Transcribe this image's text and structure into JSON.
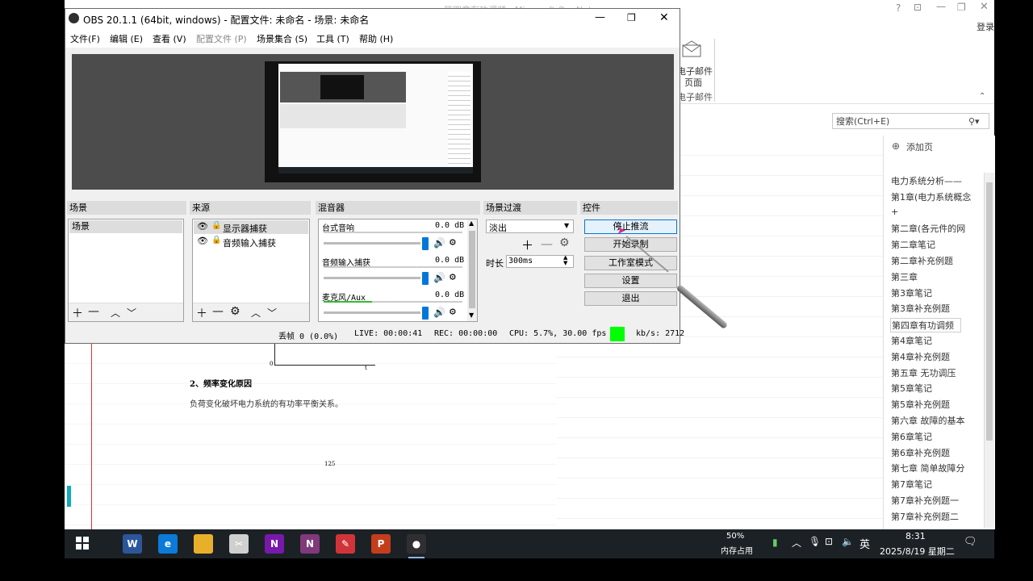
{
  "onenote": {
    "title_blurred": "第四章有功调频 - Microsoft OneNote",
    "signin": "登录",
    "ribbon": {
      "email_page_line1": "电子邮件",
      "email_page_line2": "页面",
      "group_label": "电子邮件"
    },
    "search_placeholder": "搜索(Ctrl+E)",
    "add_page": "添加页",
    "pages": [
      "电力系统分析——",
      "第1章(电力系统概念",
      "+",
      "第二章(各元件的网",
      "第二章笔记",
      "第二章补充例题",
      "第三章",
      "第3章笔记",
      "第3章补充例题",
      "第四章有功调频",
      "第4章笔记",
      "第4章补充例题",
      "第五章  无功调压",
      "第5章笔记",
      "第5章补充例题",
      "第六章 故障的基本",
      "第6章笔记",
      "第6章补充例题",
      "第七章 简单故障分",
      "第7章笔记",
      "第7章补充例题一",
      "第7章补充例题二"
    ],
    "selected_page_index": 9,
    "doc": {
      "axis_origin": "0",
      "axis_t": "t",
      "heading": "2、频率变化原因",
      "body": "负荷变化破坏电力系统的有功率平衡关系。",
      "page_number": "125"
    }
  },
  "obs": {
    "title": "OBS 20.1.1 (64bit, windows) - 配置文件: 未命名 - 场景: 未命名",
    "menu": [
      "文件(F)",
      "编辑 (E)",
      "查看 (V)",
      "配置文件 (P)",
      "场景集合 (S)",
      "工具 (T)",
      "帮助 (H)"
    ],
    "docks": {
      "scenes": {
        "header": "场景",
        "items": [
          "场景"
        ]
      },
      "sources": {
        "header": "来源",
        "items": [
          "显示器捕获",
          "音频输入捕获"
        ]
      },
      "mixer": {
        "header": "混音器",
        "tracks": [
          {
            "name": "台式音响",
            "db": "0.0 dB"
          },
          {
            "name": "音频输入捕获",
            "db": "0.0 dB"
          },
          {
            "name": "麦克风/Aux",
            "db": "0.0 dB"
          }
        ]
      },
      "transitions": {
        "header": "场景过渡",
        "selected": "淡出",
        "duration_label": "时长",
        "duration_value": "300ms"
      },
      "controls": {
        "header": "控件",
        "buttons": [
          "停止推流",
          "开始录制",
          "工作室模式",
          "设置",
          "退出"
        ]
      }
    },
    "status": {
      "dropped": "丢帧 0 (0.0%)",
      "live": "LIVE: 00:00:41",
      "rec": "REC: 00:00:00",
      "cpu": "CPU: 5.7%, 30.00 fps",
      "kbps": "kb/s: 2712",
      "indicator_color": "#00ff00"
    }
  },
  "taskbar": {
    "memory_pct": "50%",
    "memory_label": "内存占用",
    "ime": "英",
    "time": "8:31",
    "date": "2025/8/19 星期二",
    "apps": [
      {
        "icon": "word-icon",
        "label": "W",
        "color": "#2b579a"
      },
      {
        "icon": "edge-icon",
        "label": "e",
        "color": "#0c7ad8"
      },
      {
        "icon": "explorer-icon",
        "label": "",
        "color": "#e8b02a"
      },
      {
        "icon": "snipping-icon",
        "label": "✂",
        "color": "#cfcfcf"
      },
      {
        "icon": "onenote-icon",
        "label": "N",
        "color": "#7719aa"
      },
      {
        "icon": "onenote2-icon",
        "label": "N",
        "color": "#80397b"
      },
      {
        "icon": "notepad-icon",
        "label": "✎",
        "color": "#d13438"
      },
      {
        "icon": "powerpoint-icon",
        "label": "P",
        "color": "#c43e1c"
      },
      {
        "icon": "obs-icon",
        "label": "●",
        "color": "#302e31"
      }
    ]
  }
}
